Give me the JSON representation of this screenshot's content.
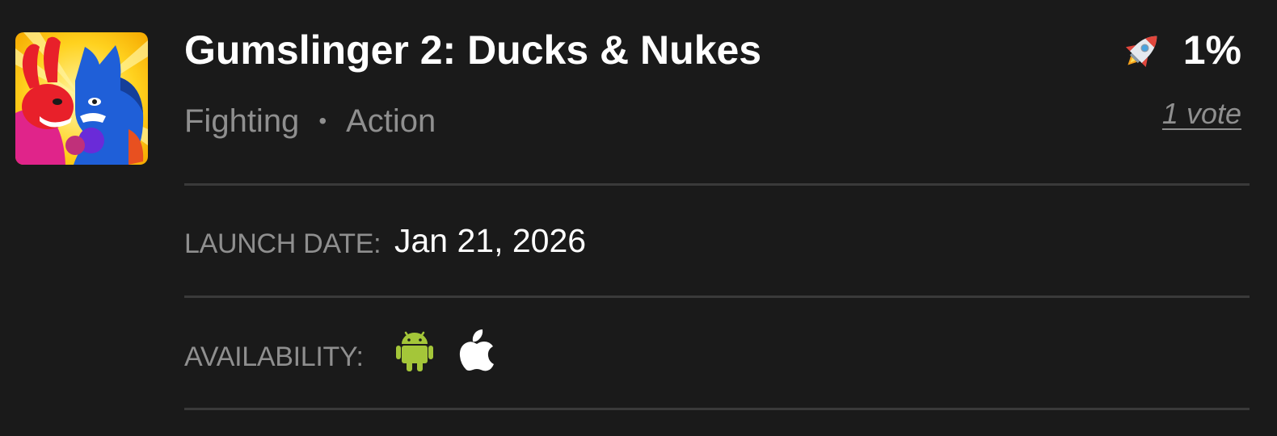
{
  "game": {
    "title": "Gumslinger 2: Ducks & Nukes",
    "thumbnail_icon": "game-art-rabbit-vs-blue-cat",
    "genres": [
      "Fighting",
      "Action"
    ],
    "genre_separator": "•",
    "score": {
      "icon": "rocket-icon",
      "percent_label": "1%",
      "votes_label": "1 vote"
    },
    "launch_date": {
      "label": "LAUNCH DATE:",
      "value": "Jan 21, 2026"
    },
    "availability": {
      "label": "AVAILABILITY:",
      "platforms": [
        {
          "name": "android",
          "icon": "android-icon",
          "color": "#a4c639"
        },
        {
          "name": "ios",
          "icon": "apple-icon",
          "color": "#ffffff"
        }
      ]
    }
  },
  "colors": {
    "background": "#1a1a1a",
    "muted_text": "#8f8f8f",
    "divider": "#3a3a3a"
  }
}
